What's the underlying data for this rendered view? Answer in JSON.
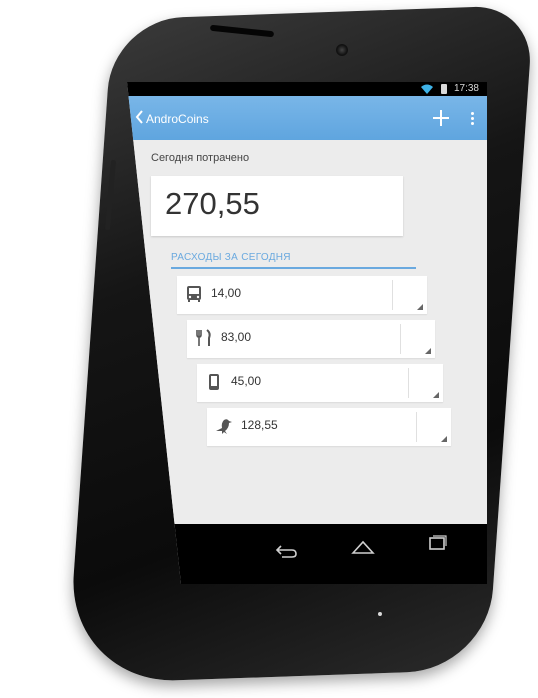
{
  "status": {
    "time": "17:38"
  },
  "action_bar": {
    "title": "AndroCoins",
    "add_icon": "plus-icon",
    "menu_icon": "overflow-menu-icon"
  },
  "summary": {
    "label": "Сегодня потрачено",
    "amount": "270,55"
  },
  "section": {
    "title": "РАСХОДЫ ЗА СЕГОДНЯ"
  },
  "expenses": [
    {
      "icon": "bus-icon",
      "amount": "14,00",
      "category": ""
    },
    {
      "icon": "fork-knife-icon",
      "amount": "83,00",
      "category": ""
    },
    {
      "icon": "phone-icon",
      "amount": "45,00",
      "category": ""
    },
    {
      "icon": "bird-icon",
      "amount": "128,55",
      "category": ""
    }
  ],
  "colors": {
    "accent": "#6aa9df",
    "action_bar": "#5fa5df",
    "background": "#ececec",
    "device": "#111111"
  },
  "nav": {
    "back_icon": "nav-back-icon",
    "home_icon": "nav-home-icon",
    "recents_icon": "nav-recents-icon"
  }
}
